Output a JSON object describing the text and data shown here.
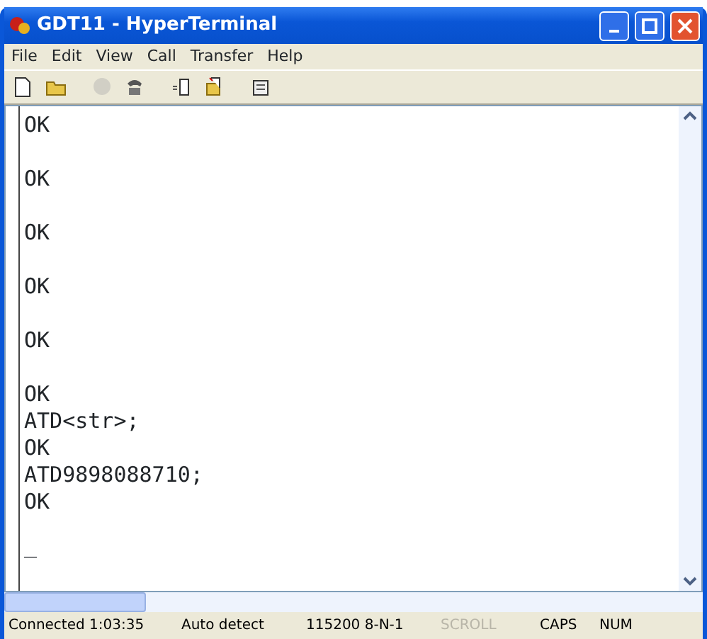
{
  "window": {
    "title": "GDT11 - HyperTerminal"
  },
  "menu": [
    "File",
    "Edit",
    "View",
    "Call",
    "Transfer",
    "Help"
  ],
  "toolbar": [
    {
      "kind": "new",
      "disabled": false
    },
    {
      "kind": "open",
      "disabled": false
    },
    {
      "kind": "disconnect",
      "disabled": true
    },
    {
      "kind": "phone",
      "disabled": false
    },
    {
      "kind": "send",
      "disabled": false
    },
    {
      "kind": "receive",
      "disabled": false
    },
    {
      "kind": "properties",
      "disabled": false
    }
  ],
  "terminal": {
    "blocks": [
      [
        "OK"
      ],
      [
        "OK"
      ],
      [
        "OK"
      ],
      [
        "OK"
      ],
      [
        "OK"
      ],
      [
        "OK",
        "ATD<str>;",
        "OK",
        "ATD9898088710;",
        "OK"
      ]
    ],
    "cursor": "_"
  },
  "status_bar": [
    {
      "text": "Connected 1:03:35",
      "disabled": false
    },
    {
      "text": "Auto detect",
      "disabled": false
    },
    {
      "text": "115200 8-N-1",
      "disabled": false
    },
    {
      "text": "SCROLL",
      "disabled": true
    },
    {
      "text": "CAPS",
      "disabled": false
    },
    {
      "text": "NUM",
      "disabled": false
    }
  ]
}
